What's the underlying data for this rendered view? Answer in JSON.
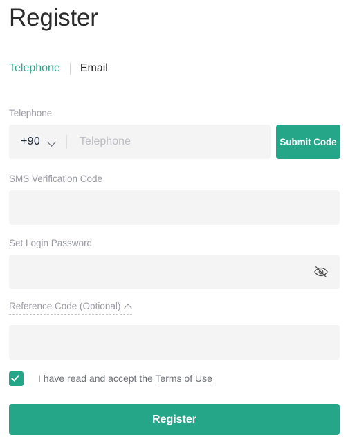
{
  "page": {
    "title": "Register"
  },
  "tabs": [
    {
      "label": "Telephone",
      "active": true
    },
    {
      "label": "Email",
      "active": false
    }
  ],
  "form": {
    "telephone": {
      "label": "Telephone",
      "country_code": "+90",
      "country_code_icon": "chevron-down-icon",
      "placeholder": "Telephone",
      "value": "",
      "submit_code_label": "Submit Code"
    },
    "sms_code": {
      "label": "SMS Verification Code",
      "placeholder": "",
      "value": ""
    },
    "password": {
      "label": "Set Login Password",
      "placeholder": "",
      "value": "",
      "visibility_icon": "eye-off-icon"
    },
    "reference_code": {
      "label": "Reference Code (Optional)",
      "toggle_icon": "chevron-up-icon",
      "placeholder": "",
      "value": ""
    },
    "terms": {
      "checked": true,
      "text_prefix": "I have read and accept the ",
      "link_label": "Terms of Use"
    },
    "submit_label": "Register"
  },
  "colors": {
    "accent": "#26a689",
    "accent_text": "#2aa787",
    "label": "#9a9aa5",
    "input_bg": "#f4f4f4",
    "title": "#2b2b2b"
  }
}
